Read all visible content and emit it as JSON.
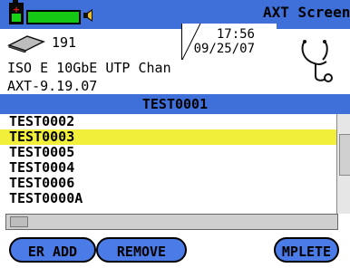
{
  "header": {
    "app_title": "AXT Screen",
    "level_percent": 100
  },
  "info": {
    "count": "191",
    "time": "17:56",
    "date": "09/25/07",
    "line1": "ISO E 10GbE UTP Chan",
    "line2": "AXT-9.19.07"
  },
  "list": {
    "header": "TEST0001",
    "items": [
      "TEST0002",
      "TEST0003",
      "TEST0005",
      "TEST0004",
      "TEST0006",
      "TEST0000A"
    ],
    "selected_index": 1
  },
  "buttons": {
    "add": "ER ADD",
    "remove": "REMOVE",
    "complete": "MPLETE"
  },
  "colors": {
    "blue": "#3f6fd9",
    "highlight": "#f2ef3a",
    "green": "#14c814"
  },
  "icons": [
    "battery-icon",
    "speaker-icon",
    "tape-icon",
    "stethoscope-icon"
  ]
}
